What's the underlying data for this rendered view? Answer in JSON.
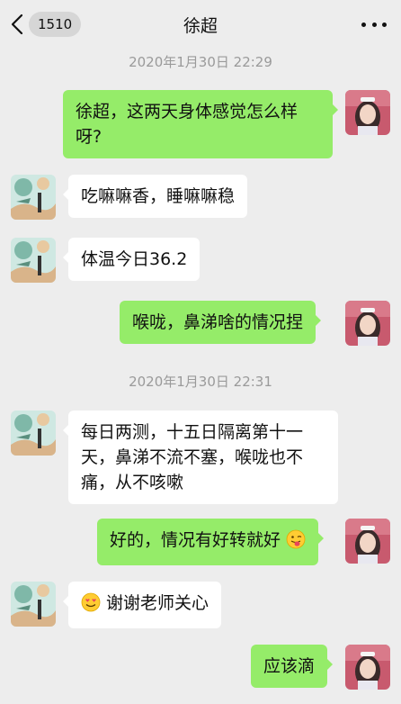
{
  "header": {
    "badge_count": "1510",
    "title": "徐超"
  },
  "timestamps": [
    "2020年1月30日 22:29",
    "2020年1月30日 22:31"
  ],
  "messages": [
    {
      "side": "out",
      "text": "徐超，这两天身体感觉怎么样呀?"
    },
    {
      "side": "in",
      "text": "吃嘛嘛香，睡嘛嘛稳"
    },
    {
      "side": "in",
      "text": "体温今日36.2"
    },
    {
      "side": "out",
      "text": "喉咙，鼻涕啥的情况捏"
    },
    {
      "side": "in",
      "text": "每日两测，十五日隔离第十一天，鼻涕不流不塞，喉咙也不痛，从不咳嗽"
    },
    {
      "side": "out",
      "text": "好的，情况有好转就好",
      "emoji": "tongue-wink-emoji"
    },
    {
      "side": "in",
      "text": "谢谢老师关心",
      "emoji": "heart-eyes-emoji"
    },
    {
      "side": "out",
      "text": "应该滴"
    }
  ],
  "colors": {
    "background": "#ededed",
    "bubble_out": "#95ec69",
    "bubble_in": "#ffffff",
    "timestamp": "#9a9a9a"
  }
}
